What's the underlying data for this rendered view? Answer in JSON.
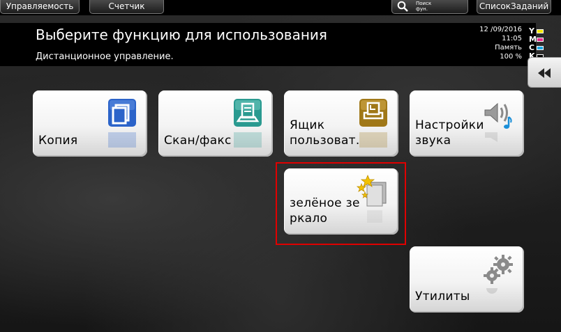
{
  "topbar": {
    "manage_label": "Управляемость",
    "counter_label": "Счетчик",
    "search_label_line1": "Поиск",
    "search_label_line2": "фун.",
    "joblist_label": "СписокЗаданий"
  },
  "header": {
    "title": "Выберите функцию для использования",
    "subtitle": "Дистанционное управление.",
    "date": "12 /09/2016",
    "time": "11:05",
    "memory_label": "Память",
    "memory_value": "100 %",
    "toner": [
      {
        "letter": "Y",
        "color": "#f3e600"
      },
      {
        "letter": "M",
        "color": "#e8288c"
      },
      {
        "letter": "C",
        "color": "#1fa6e0"
      },
      {
        "letter": "K",
        "color": "#000000"
      }
    ]
  },
  "tiles": {
    "copy": {
      "label": "Копия",
      "icon": "copy-icon"
    },
    "scan": {
      "label": "Скан/факс",
      "icon": "scan-fax-icon"
    },
    "box": {
      "label_line1": "Ящик",
      "label_line2": "пользоват.",
      "icon": "user-box-icon"
    },
    "sound": {
      "label_line1": "Настройки",
      "label_line2": "звука",
      "icon": "speaker-icon"
    },
    "green": {
      "label_line1": "зелёное зе",
      "label_line2": "ркало",
      "icon": "green-mirror-icon"
    },
    "utilities": {
      "label": "Утилиты",
      "icon": "gear-icon"
    }
  },
  "colors": {
    "copy_icon": "#2b63c9",
    "scan_icon": "#2a9a90",
    "box_icon": "#a07818",
    "highlight": "#e00000"
  }
}
